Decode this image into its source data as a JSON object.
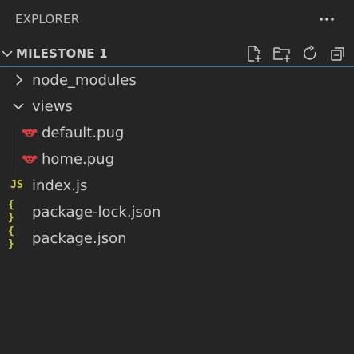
{
  "explorer": {
    "title": "EXPLORER",
    "more_actions_icon": "ellipsis-icon"
  },
  "section": {
    "title": "MILESTONE 1",
    "actions": [
      {
        "name": "new-file-button",
        "icon": "new-file-icon"
      },
      {
        "name": "new-folder-button",
        "icon": "new-folder-icon"
      },
      {
        "name": "refresh-button",
        "icon": "refresh-icon"
      },
      {
        "name": "collapse-all-button",
        "icon": "collapse-all-icon"
      }
    ]
  },
  "tree": {
    "items": [
      {
        "label": "node_modules",
        "type": "folder",
        "expanded": false
      },
      {
        "label": "views",
        "type": "folder",
        "expanded": true
      },
      {
        "label": "default.pug",
        "type": "file",
        "icon": "pug-icon"
      },
      {
        "label": "home.pug",
        "type": "file",
        "icon": "pug-icon"
      },
      {
        "label": "index.js",
        "type": "file",
        "icon": "js-icon",
        "icon_text": "JS"
      },
      {
        "label": "package-lock.json",
        "type": "file",
        "icon": "json-icon",
        "icon_text": "{ }"
      },
      {
        "label": "package.json",
        "type": "file",
        "icon": "json-icon",
        "icon_text": "{ }"
      }
    ]
  },
  "colors": {
    "background": "#252526",
    "text": "#cccccc",
    "focus_border": "#2b79b4",
    "js_icon": "#cbcb41",
    "json_icon": "#cbcb41",
    "pug_icon": "#cc3e44"
  }
}
